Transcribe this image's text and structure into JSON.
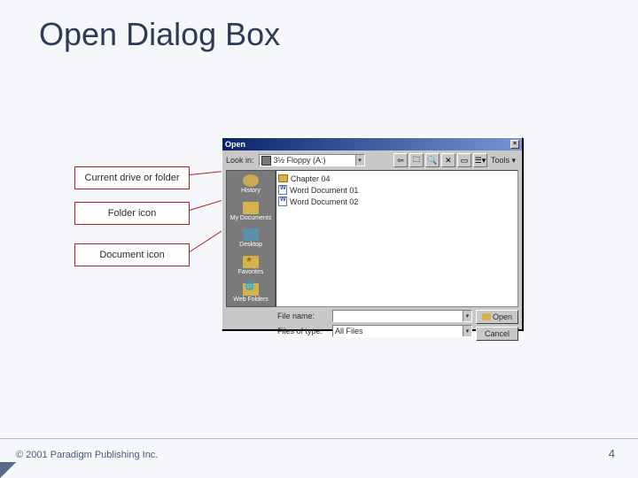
{
  "slide": {
    "title": "Open Dialog Box",
    "footer": "© 2001 Paradigm Publishing Inc.",
    "page": "4"
  },
  "callouts": {
    "current_drive": "Current drive or folder",
    "folder_icon": "Folder icon",
    "document_icon": "Document icon"
  },
  "dialog": {
    "title": "Open",
    "lookin_label": "Look in:",
    "lookin_value": "3½ Floppy (A:)",
    "tools_label": "Tools",
    "places": {
      "history": "History",
      "mydocs": "My Documents",
      "desktop": "Desktop",
      "favorites": "Favorites",
      "web": "Web Folders"
    },
    "files": [
      {
        "kind": "folder",
        "name": "Chapter 04"
      },
      {
        "kind": "doc",
        "name": "Word Document 01"
      },
      {
        "kind": "doc",
        "name": "Word Document 02"
      }
    ],
    "filename_label": "File name:",
    "filename_value": "",
    "filetype_label": "Files of type:",
    "filetype_value": "All Files",
    "open_btn": "Open",
    "cancel_btn": "Cancel"
  }
}
